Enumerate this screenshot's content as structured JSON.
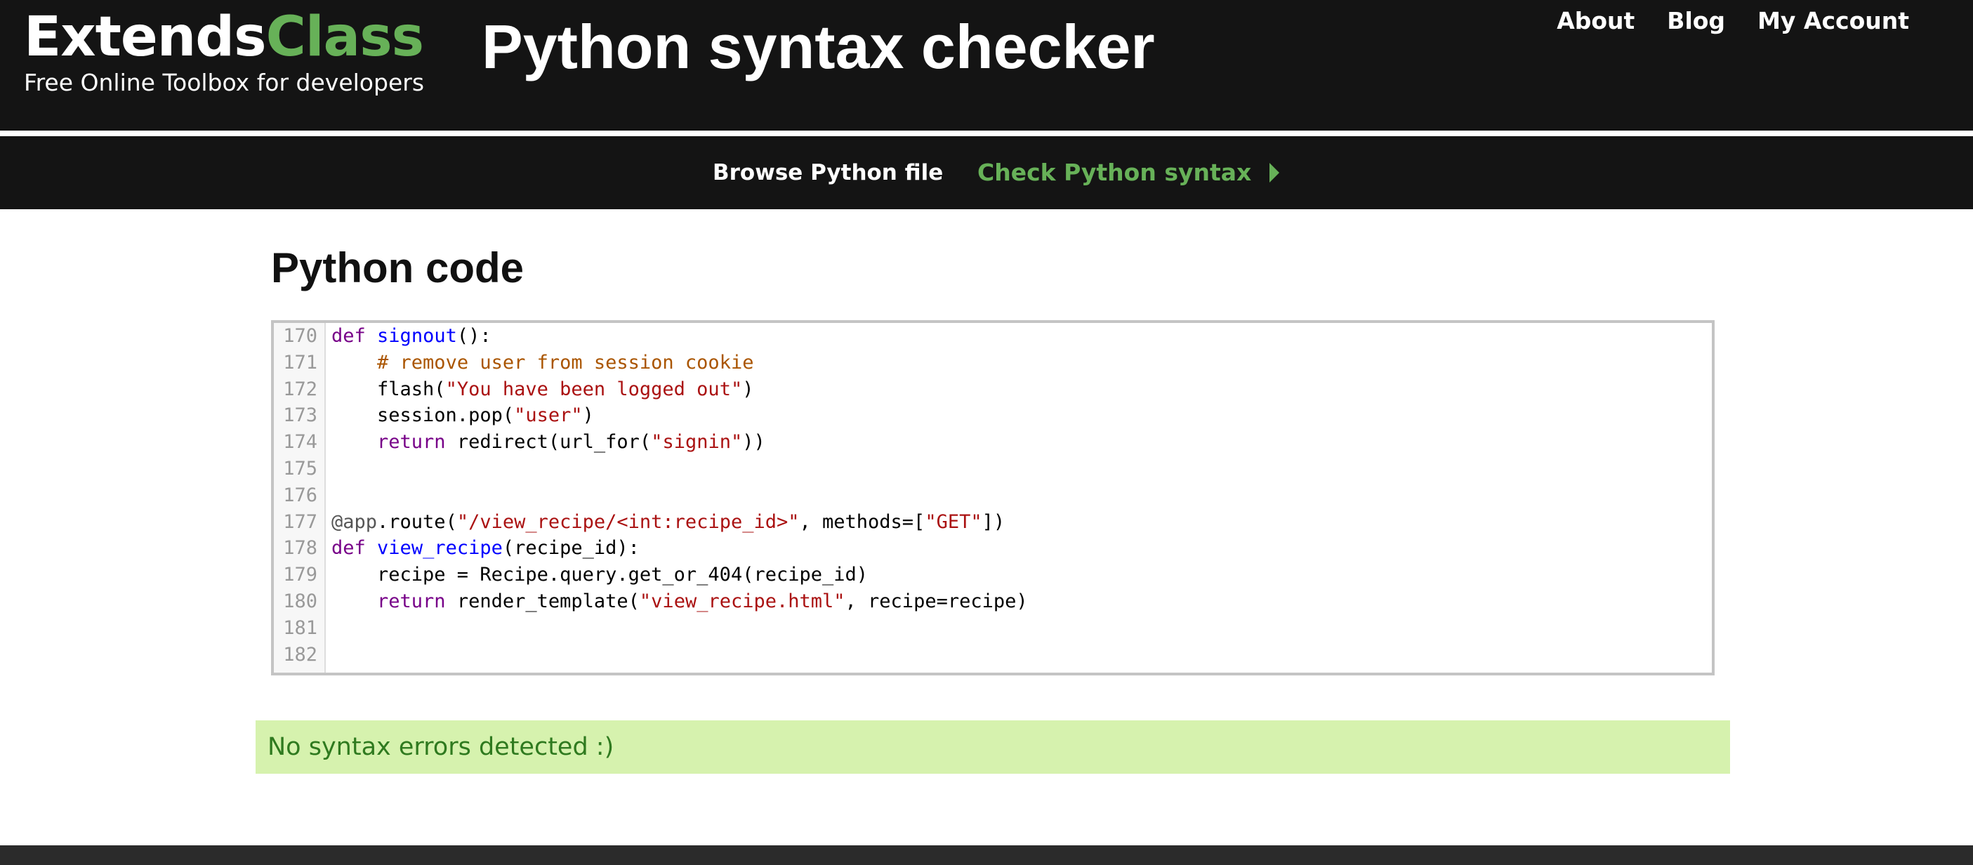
{
  "header": {
    "brand_part1": "Extends",
    "brand_part2": "Class",
    "tagline": "Free Online Toolbox for developers",
    "title": "Python syntax checker",
    "nav": [
      "About",
      "Blog",
      "My Account"
    ]
  },
  "subnav": {
    "browse_label": "Browse Python file",
    "check_label": "Check Python syntax"
  },
  "section_title": "Python code",
  "editor": {
    "lines": [
      {
        "n": "170",
        "tokens": [
          {
            "t": "def",
            "c": "kw"
          },
          {
            "t": " "
          },
          {
            "t": "signout",
            "c": "def"
          },
          {
            "t": "():"
          }
        ]
      },
      {
        "n": "171",
        "tokens": [
          {
            "t": "    "
          },
          {
            "t": "# remove user from session cookie",
            "c": "cm"
          }
        ]
      },
      {
        "n": "172",
        "tokens": [
          {
            "t": "    flash("
          },
          {
            "t": "\"You have been logged out\"",
            "c": "str"
          },
          {
            "t": ")"
          }
        ]
      },
      {
        "n": "173",
        "tokens": [
          {
            "t": "    session.pop("
          },
          {
            "t": "\"user\"",
            "c": "str"
          },
          {
            "t": ")"
          }
        ]
      },
      {
        "n": "174",
        "tokens": [
          {
            "t": "    "
          },
          {
            "t": "return",
            "c": "kw"
          },
          {
            "t": " redirect(url_for("
          },
          {
            "t": "\"signin\"",
            "c": "str"
          },
          {
            "t": "))"
          }
        ]
      },
      {
        "n": "175",
        "tokens": []
      },
      {
        "n": "176",
        "tokens": []
      },
      {
        "n": "177",
        "tokens": [
          {
            "t": "@app",
            "c": "dec"
          },
          {
            "t": ".route("
          },
          {
            "t": "\"/view_recipe/<int:recipe_id>\"",
            "c": "str"
          },
          {
            "t": ", methods=["
          },
          {
            "t": "\"GET\"",
            "c": "str"
          },
          {
            "t": "])"
          }
        ]
      },
      {
        "n": "178",
        "tokens": [
          {
            "t": "def",
            "c": "kw"
          },
          {
            "t": " "
          },
          {
            "t": "view_recipe",
            "c": "def"
          },
          {
            "t": "(recipe_id):"
          }
        ]
      },
      {
        "n": "179",
        "tokens": [
          {
            "t": "    recipe = Recipe.query.get_or_404(recipe_id)"
          }
        ]
      },
      {
        "n": "180",
        "tokens": [
          {
            "t": "    "
          },
          {
            "t": "return",
            "c": "kw"
          },
          {
            "t": " render_template("
          },
          {
            "t": "\"view_recipe.html\"",
            "c": "str"
          },
          {
            "t": ", recipe=recipe)"
          }
        ]
      },
      {
        "n": "181",
        "tokens": []
      },
      {
        "n": "182",
        "tokens": []
      }
    ]
  },
  "result": {
    "message": "No syntax errors detected :)"
  },
  "colors": {
    "accent_green": "#67b158",
    "header_bg": "#141414",
    "success_bg": "#d6f2ae",
    "success_text": "#2f7a1f"
  }
}
